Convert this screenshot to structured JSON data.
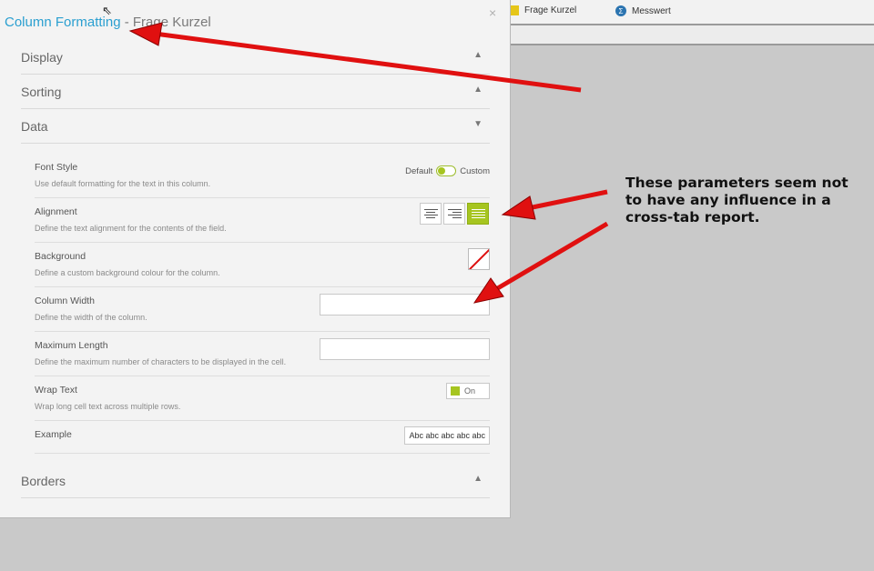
{
  "background": {
    "fields": [
      {
        "label": "Frage Kurzel",
        "icon": "dimension-square-icon"
      },
      {
        "label": "Messwert",
        "icon": "sum-icon",
        "glyph": "Σ"
      }
    ]
  },
  "dialog": {
    "title": "Column Formatting",
    "subtitle": "- Frage Kurzel",
    "close_glyph": "×",
    "sections": {
      "display": {
        "label": "Display",
        "chevron": "▲"
      },
      "sorting": {
        "label": "Sorting",
        "chevron": "▲"
      },
      "data": {
        "label": "Data",
        "chevron": "▼"
      },
      "borders": {
        "label": "Borders",
        "chevron": "▲"
      }
    },
    "rows": {
      "font_style": {
        "title": "Font Style",
        "desc": "Use default formatting for the text in this column.",
        "left": "Default",
        "right": "Custom"
      },
      "alignment": {
        "title": "Alignment",
        "desc": "Define the text alignment for the contents of the field.",
        "selected": "justify"
      },
      "background": {
        "title": "Background",
        "desc": "Define a custom background colour for the column."
      },
      "column_width": {
        "title": "Column Width",
        "desc": "Define the width of the column.",
        "value": ""
      },
      "max_length": {
        "title": "Maximum Length",
        "desc": "Define the maximum number of characters to be displayed in the cell.",
        "value": ""
      },
      "wrap_text": {
        "title": "Wrap Text",
        "desc": "Wrap long cell text across multiple rows.",
        "state": "On"
      },
      "example": {
        "title": "Example",
        "sample": "Abc abc abc abc abc"
      }
    }
  },
  "annotation": {
    "text": "These parameters seem not to have any influence in a cross-tab report.",
    "arrow_color": "#e01010"
  },
  "colors": {
    "accent": "#2a9fd0",
    "toggle_green": "#a6c520"
  }
}
